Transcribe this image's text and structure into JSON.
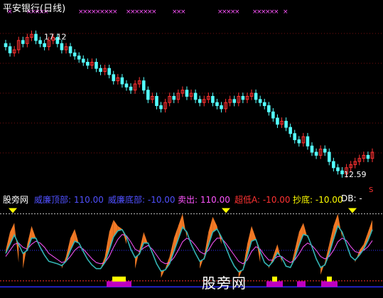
{
  "title": "平安银行(日线)",
  "colors": {
    "background": "#000000",
    "up_candle": "#ff3232",
    "down_candle": "#54ffff",
    "grid": "#7a1010",
    "title_text": "#ffffff",
    "bottom_line": "#2a2aff",
    "top_line": "#c0c0c0",
    "mid_line": "#c0c0c0",
    "orange_fill": "#ff7f27",
    "cyan_line": "#33b3b3",
    "magenta_line": "#ff55ff",
    "purple_fill": "#c000c0",
    "yellow": "#ffff00"
  },
  "price_chart": {
    "high_label": "17.12",
    "low_label": "12.59",
    "corner_icon": "arrow-icon",
    "price_min": 12.2,
    "price_max": 17.7
  },
  "indicator": {
    "name": "股旁网",
    "items": [
      {
        "label": "威廉顶部: 110.00",
        "color": "#5050ff"
      },
      {
        "label": "威廉底部: -10.00",
        "color": "#5050ff"
      },
      {
        "label": "卖出: 110.00",
        "color": "#ff55ff"
      },
      {
        "label": "超低A: -10.00",
        "color": "#ff3232"
      },
      {
        "label": "抄底: -10.00",
        "color": "#ffff00"
      },
      {
        "label": "DB: -",
        "color": "#ffffff"
      }
    ]
  },
  "watermark": "股旁网",
  "chart_data": {
    "type": "candlestick",
    "title": "平安银行(日线)",
    "price_annotations": {
      "high": 17.12,
      "low": 12.59
    },
    "y_range": [
      12.2,
      17.7
    ],
    "close_series": [
      16.7,
      16.5,
      16.6,
      16.9,
      16.8,
      17.0,
      17.1,
      16.9,
      16.8,
      16.7,
      16.9,
      17.0,
      16.8,
      16.6,
      16.7,
      16.5,
      16.4,
      16.3,
      16.2,
      16.1,
      16.2,
      16.0,
      15.9,
      16.0,
      15.8,
      15.6,
      15.7,
      15.5,
      15.4,
      15.3,
      15.5,
      15.6,
      15.3,
      15.0,
      15.1,
      14.8,
      14.7,
      14.9,
      15.1,
      15.0,
      15.2,
      15.3,
      15.1,
      15.2,
      15.0,
      14.9,
      15.0,
      15.1,
      14.9,
      14.8,
      14.7,
      14.9,
      15.0,
      14.9,
      15.1,
      15.0,
      15.1,
      15.2,
      15.0,
      14.9,
      14.8,
      14.6,
      14.4,
      14.2,
      14.3,
      14.1,
      13.9,
      13.7,
      13.6,
      13.8,
      13.5,
      13.3,
      13.2,
      13.4,
      13.3,
      13.0,
      12.8,
      12.7,
      12.6,
      12.8,
      12.9,
      13.0,
      13.1,
      13.2,
      13.1,
      13.3
    ],
    "indicator_levels": {
      "威廉顶部": 110,
      "威廉底部": -10,
      "卖出": 110,
      "超低A": -10,
      "抄底": -10
    },
    "indicator_range": [
      -20,
      120
    ],
    "wr_series": [
      50,
      80,
      95,
      30,
      20,
      60,
      90,
      70,
      40,
      30,
      20,
      30,
      25,
      20,
      40,
      70,
      85,
      60,
      30,
      20,
      15,
      10,
      20,
      40,
      80,
      100,
      90,
      85,
      60,
      30,
      20,
      50,
      80,
      60,
      30,
      10,
      5,
      20,
      40,
      70,
      90,
      110,
      70,
      40,
      30,
      20,
      40,
      80,
      105,
      90,
      60,
      40,
      20,
      10,
      5,
      20,
      60,
      90,
      70,
      30,
      15,
      20,
      40,
      60,
      30,
      10,
      20,
      50,
      80,
      95,
      70,
      40,
      20,
      10,
      30,
      60,
      90,
      110,
      70,
      40,
      20,
      30,
      50,
      60,
      80,
      100
    ],
    "slow_series": [
      45,
      60,
      75,
      60,
      45,
      50,
      70,
      70,
      55,
      42,
      32,
      30,
      28,
      25,
      32,
      50,
      65,
      62,
      48,
      35,
      26,
      20,
      20,
      30,
      50,
      72,
      82,
      84,
      72,
      52,
      38,
      44,
      62,
      62,
      46,
      28,
      16,
      18,
      28,
      48,
      68,
      88,
      80,
      60,
      45,
      32,
      36,
      58,
      80,
      85,
      72,
      56,
      38,
      24,
      15,
      18,
      40,
      65,
      68,
      48,
      30,
      24,
      32,
      46,
      38,
      24,
      22,
      36,
      58,
      76,
      74,
      56,
      36,
      22,
      26,
      44,
      68,
      90,
      80,
      60,
      40,
      34,
      42,
      52,
      66,
      84
    ],
    "magenta_series": [
      40,
      50,
      60,
      62,
      55,
      52,
      60,
      65,
      62,
      55,
      45,
      40,
      35,
      30,
      32,
      40,
      50,
      56,
      52,
      44,
      36,
      30,
      28,
      30,
      40,
      55,
      68,
      76,
      74,
      64,
      52,
      48,
      54,
      58,
      52,
      42,
      32,
      28,
      30,
      38,
      50,
      64,
      70,
      66,
      58,
      48,
      44,
      50,
      62,
      70,
      70,
      62,
      52,
      42,
      32,
      28,
      34,
      48,
      56,
      52,
      42,
      34,
      34,
      40,
      40,
      34,
      30,
      34,
      44,
      56,
      62,
      58,
      50,
      40,
      36,
      40,
      50,
      64,
      70,
      66,
      56,
      48,
      46,
      50,
      56,
      66
    ]
  }
}
